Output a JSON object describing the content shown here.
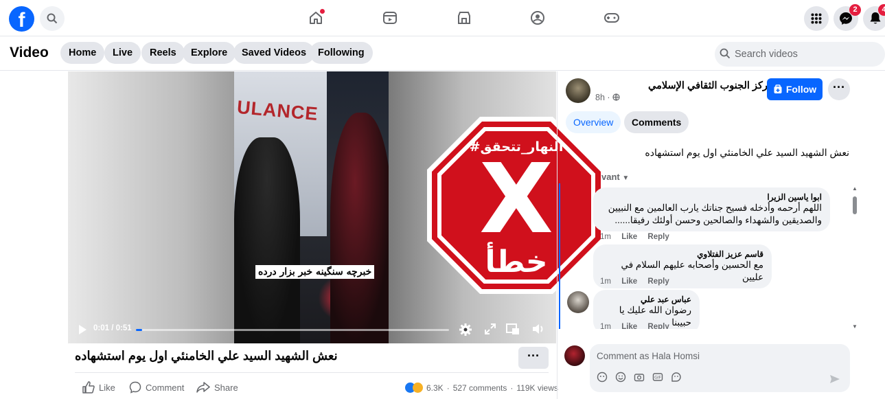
{
  "nav": {
    "logo": "f",
    "notifications_badge": "4",
    "messenger_badge": "2"
  },
  "subnav": {
    "title": "Video",
    "tabs": [
      "Home",
      "Live",
      "Reels",
      "Explore",
      "Saved Videos",
      "Following"
    ],
    "search_placeholder": "Search videos"
  },
  "video": {
    "ambulance_text": "ULANCE",
    "caption_overlay": "خبرچه سنگینه خبر بزار درده",
    "time": "0:01 / 0:51",
    "progress": 0.02,
    "stamp_hashtag": "#النهار_تتحقق",
    "stamp_mark": "X",
    "stamp_verdict": "خطأ",
    "title": "نعش الشهيد السيد علي الخامنئي اول يوم استشهاده",
    "more": "···"
  },
  "actions": {
    "like": "Like",
    "comment": "Comment",
    "share": "Share"
  },
  "stats": {
    "reactions": "6.3K",
    "comments": "527 comments",
    "views": "119K views",
    "separator": "·"
  },
  "sidebar": {
    "page_name": "مركز الجنوب الثقافي الإسلامي",
    "time": "8h ·",
    "follow_label": "Follow",
    "more": "···",
    "tab_overview": "Overview",
    "tab_comments": "Comments",
    "description": "نعش الشهيد السيد علي الخامنئي اول يوم استشهاده",
    "filter": "vant",
    "comments": [
      {
        "author": "ابوا ياسين الزيرا",
        "text": "اللهم أرحمه وأدخله فسيح جناتك يارب العالمين مع النبيين والصديقين والشهداء والصالحين وحسن أولئك رفيقا......",
        "time": "1m",
        "like": "Like",
        "reply": "Reply"
      },
      {
        "author": "قاسم عزيز الفتلاوي",
        "text": "مع الحسين وأصحابه عليهم السلام في علیین",
        "time": "1m",
        "like": "Like",
        "reply": "Reply"
      },
      {
        "author": "عباس عبد علي",
        "text": "رضوان الله عليك يا حبيبنا",
        "time": "1m",
        "like": "Like",
        "reply": "Reply"
      }
    ],
    "comment_placeholder": "Comment as Hala Homsi"
  },
  "colors": {
    "brand": "#0866ff",
    "stamp_red": "#d0101c",
    "badge": "#e41e3f"
  }
}
